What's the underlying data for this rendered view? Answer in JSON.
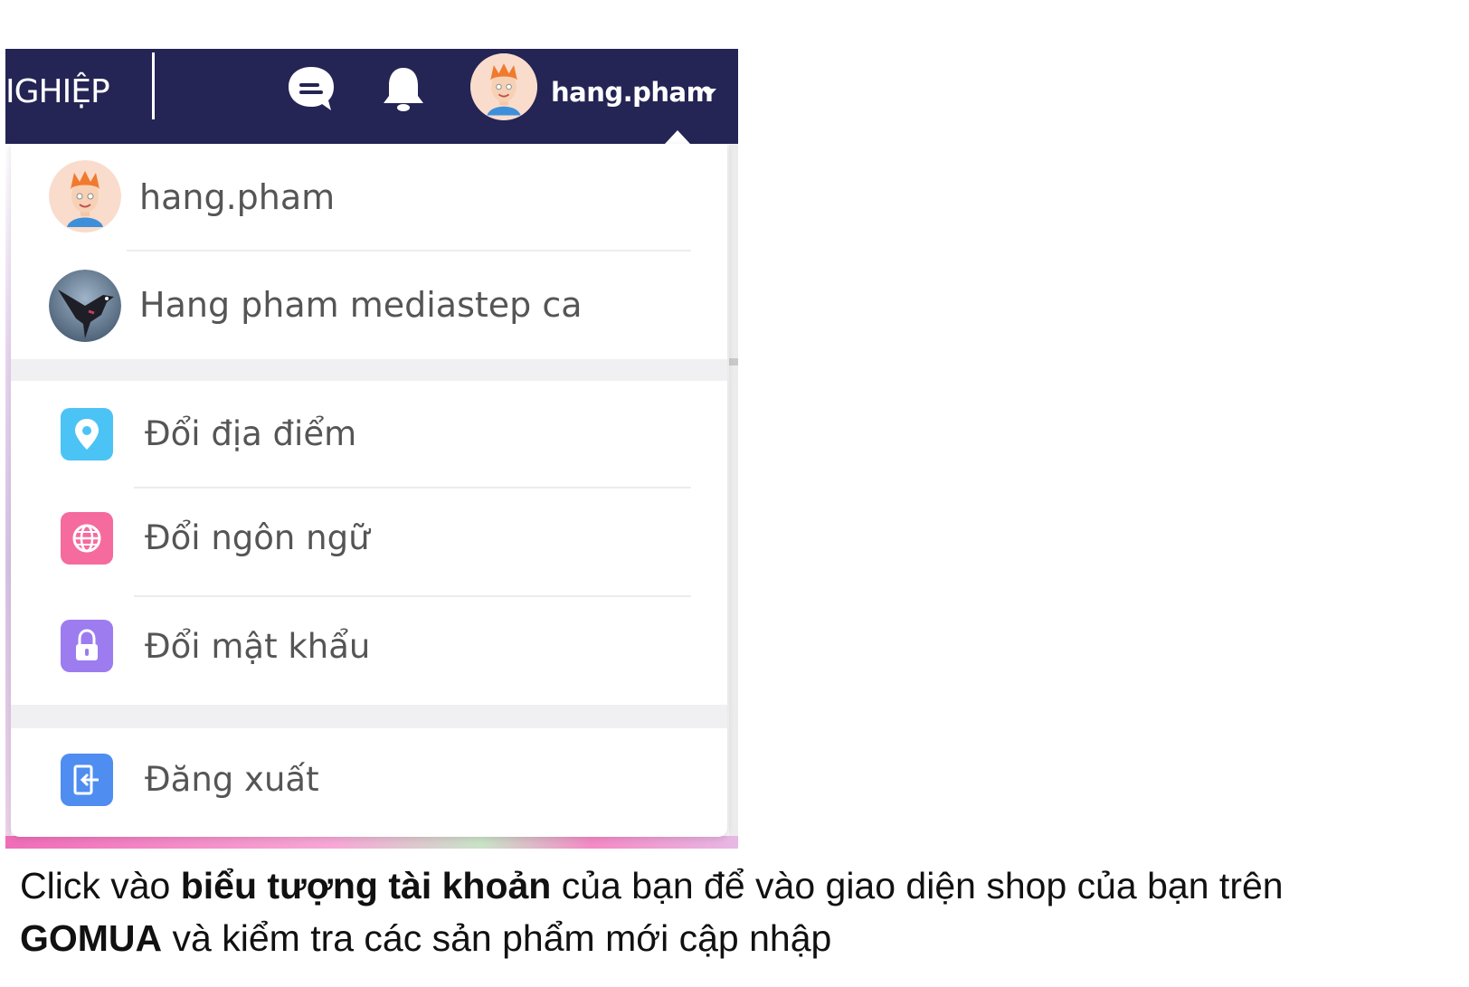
{
  "navbar": {
    "brand_text": "IGHIỆP",
    "username": "hang.pham",
    "chat_icon": "chat-bubble-icon",
    "bell_icon": "bell-icon",
    "caret_icon": "caret-down-icon",
    "background": "#242455"
  },
  "dropdown": {
    "accounts": [
      {
        "name": "hang.pham",
        "avatar": "cartoon-boy-avatar"
      },
      {
        "name": "Hang pham mediastep ca",
        "avatar": "bird-avatar"
      }
    ],
    "menu": [
      {
        "label": "Đổi địa điểm",
        "icon": "location-pin-icon",
        "color": "#4cc3f5"
      },
      {
        "label": "Đổi ngôn ngữ",
        "icon": "globe-icon",
        "color": "#f56b9d"
      },
      {
        "label": "Đổi mật khẩu",
        "icon": "lock-icon",
        "color": "#9d7cf0"
      }
    ],
    "logout": {
      "label": "Đăng xuất",
      "icon": "logout-icon",
      "color": "#4f8df0"
    }
  },
  "caption": {
    "part1": "Click vào ",
    "bold1": "biểu tượng tài khoản",
    "part2": " của bạn để vào giao diện shop của bạn trên ",
    "bold2": "GOMUA",
    "part3": " và kiểm tra các sản phẩm mới cập nhập"
  }
}
